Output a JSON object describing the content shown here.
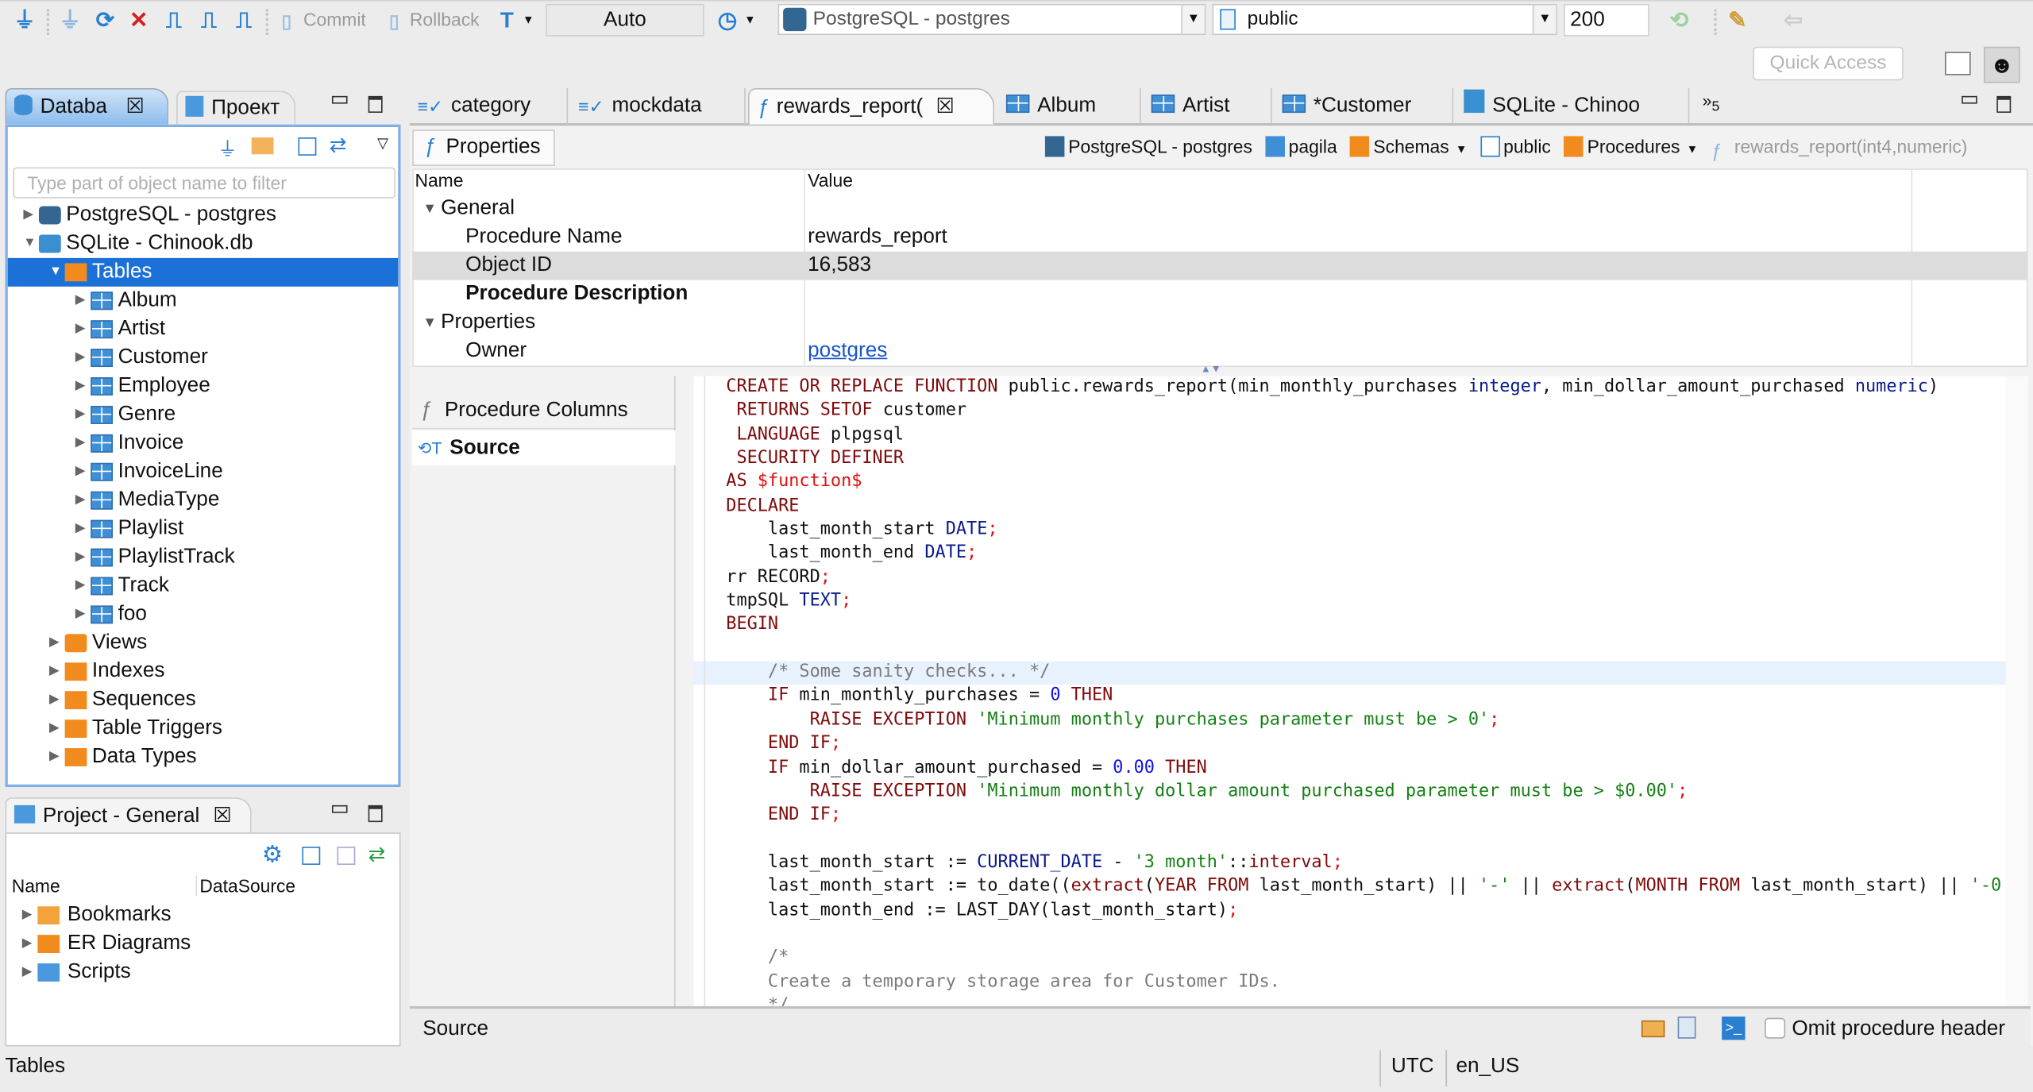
{
  "toolbar": {
    "icons": [
      "new-connection-icon",
      "connect-icon",
      "reconnect-icon",
      "disconnect-icon",
      "transaction-icon",
      "commit-mode-icon",
      "new-transaction-icon"
    ],
    "commit_label": "Commit",
    "rollback_label": "Rollback",
    "transaction_mode": "Auto",
    "connection": "PostgreSQL - postgres",
    "schema": "public",
    "result_limit": "200",
    "quick_access_placeholder": "Quick Access"
  },
  "left_panel": {
    "tabs": [
      {
        "label": "Databa",
        "active": true
      },
      {
        "label": "Проект",
        "active": false
      }
    ],
    "filter_placeholder": "Type part of object name to filter",
    "tree": [
      {
        "label": "PostgreSQL - postgres",
        "level": 0,
        "expanded": false,
        "icon": "postgres-connection"
      },
      {
        "label": "SQLite - Chinook.db",
        "level": 0,
        "expanded": true,
        "icon": "sqlite-connection"
      },
      {
        "label": "Tables",
        "level": 1,
        "expanded": true,
        "icon": "tables-folder",
        "selected": true
      },
      {
        "label": "Album",
        "level": 2,
        "expanded": false,
        "icon": "table"
      },
      {
        "label": "Artist",
        "level": 2,
        "expanded": false,
        "icon": "table"
      },
      {
        "label": "Customer",
        "level": 2,
        "expanded": false,
        "icon": "table"
      },
      {
        "label": "Employee",
        "level": 2,
        "expanded": false,
        "icon": "table"
      },
      {
        "label": "Genre",
        "level": 2,
        "expanded": false,
        "icon": "table"
      },
      {
        "label": "Invoice",
        "level": 2,
        "expanded": false,
        "icon": "table"
      },
      {
        "label": "InvoiceLine",
        "level": 2,
        "expanded": false,
        "icon": "table"
      },
      {
        "label": "MediaType",
        "level": 2,
        "expanded": false,
        "icon": "table"
      },
      {
        "label": "Playlist",
        "level": 2,
        "expanded": false,
        "icon": "table"
      },
      {
        "label": "PlaylistTrack",
        "level": 2,
        "expanded": false,
        "icon": "table"
      },
      {
        "label": "Track",
        "level": 2,
        "expanded": false,
        "icon": "table"
      },
      {
        "label": "foo",
        "level": 2,
        "expanded": false,
        "icon": "table"
      },
      {
        "label": "Views",
        "level": 1,
        "expanded": false,
        "icon": "views"
      },
      {
        "label": "Indexes",
        "level": 1,
        "expanded": false,
        "icon": "folder"
      },
      {
        "label": "Sequences",
        "level": 1,
        "expanded": false,
        "icon": "folder"
      },
      {
        "label": "Table Triggers",
        "level": 1,
        "expanded": false,
        "icon": "folder"
      },
      {
        "label": "Data Types",
        "level": 1,
        "expanded": false,
        "icon": "folder"
      }
    ]
  },
  "project_panel": {
    "tab_label": "Project - General",
    "columns": [
      "Name",
      "DataSource"
    ],
    "items": [
      {
        "label": "Bookmarks",
        "icon": "bookmarks"
      },
      {
        "label": "ER Diagrams",
        "icon": "er-diagrams"
      },
      {
        "label": "Scripts",
        "icon": "scripts"
      }
    ]
  },
  "editor": {
    "tabs": [
      {
        "label": "category",
        "icon": "sql"
      },
      {
        "label": "mockdata",
        "icon": "sql"
      },
      {
        "label": "rewards_report(",
        "icon": "function",
        "active": true
      },
      {
        "label": "Album",
        "icon": "table"
      },
      {
        "label": "Artist",
        "icon": "table"
      },
      {
        "label": "*Customer",
        "icon": "table"
      },
      {
        "label": "SQLite - Chinoo",
        "icon": "sqlite"
      }
    ],
    "overflow_count": "5",
    "subtab": "Properties",
    "breadcrumb": [
      "PostgreSQL - postgres",
      "pagila",
      "Schemas",
      "public",
      "Procedures",
      "rewards_report(int4,numeric)"
    ],
    "properties": {
      "headers": [
        "Name",
        "Value"
      ],
      "rows": [
        {
          "name": "General",
          "value": "",
          "group": true
        },
        {
          "name": "Procedure Name",
          "value": "rewards_report"
        },
        {
          "name": "Object ID",
          "value": "16,583",
          "highlight": true
        },
        {
          "name": "Procedure Description",
          "value": "",
          "bold": true
        },
        {
          "name": "Properties",
          "value": "",
          "group": true
        },
        {
          "name": "Owner",
          "value": "postgres",
          "link": true
        }
      ]
    },
    "side_tabs": [
      {
        "label": "Procedure Columns",
        "active": false
      },
      {
        "label": "Source",
        "active": true
      }
    ],
    "code": [
      [
        [
          "k",
          "CREATE OR REPLACE FUNCTION"
        ],
        [
          "p",
          " public.rewards_report(min_monthly_purchases "
        ],
        [
          "t",
          "integer"
        ],
        [
          "p",
          ", min_dollar_amount_purchased "
        ],
        [
          "t",
          "numeric"
        ],
        [
          "p",
          ")"
        ]
      ],
      [
        [
          "p",
          " "
        ],
        [
          "k",
          "RETURNS SETOF"
        ],
        [
          "p",
          " customer"
        ]
      ],
      [
        [
          "p",
          " "
        ],
        [
          "k",
          "LANGUAGE"
        ],
        [
          "p",
          " plpgsql"
        ]
      ],
      [
        [
          "p",
          " "
        ],
        [
          "k",
          "SECURITY DEFINER"
        ]
      ],
      [
        [
          "k",
          "AS"
        ],
        [
          "p",
          " "
        ],
        [
          "r",
          "$function$"
        ]
      ],
      [
        [
          "k",
          "DECLARE"
        ]
      ],
      [
        [
          "p",
          "    last_month_start "
        ],
        [
          "t",
          "DATE"
        ],
        [
          "r",
          ";"
        ]
      ],
      [
        [
          "p",
          "    last_month_end "
        ],
        [
          "t",
          "DATE"
        ],
        [
          "r",
          ";"
        ]
      ],
      [
        [
          "p",
          "rr RECORD"
        ],
        [
          "r",
          ";"
        ]
      ],
      [
        [
          "p",
          "tmpSQL "
        ],
        [
          "t",
          "TEXT"
        ],
        [
          "r",
          ";"
        ]
      ],
      [
        [
          "k",
          "BEGIN"
        ]
      ],
      [],
      [
        [
          "c",
          "    /* Some sanity checks... */"
        ]
      ],
      [
        [
          "p",
          "    "
        ],
        [
          "k",
          "IF"
        ],
        [
          "p",
          " min_monthly_purchases = "
        ],
        [
          "n",
          "0"
        ],
        [
          "p",
          " "
        ],
        [
          "k",
          "THEN"
        ]
      ],
      [
        [
          "p",
          "        "
        ],
        [
          "k",
          "RAISE EXCEPTION"
        ],
        [
          "p",
          " "
        ],
        [
          "s",
          "'Minimum monthly purchases parameter must be > 0'"
        ],
        [
          "r",
          ";"
        ]
      ],
      [
        [
          "p",
          "    "
        ],
        [
          "k",
          "END IF"
        ],
        [
          "r",
          ";"
        ]
      ],
      [
        [
          "p",
          "    "
        ],
        [
          "k",
          "IF"
        ],
        [
          "p",
          " min_dollar_amount_purchased = "
        ],
        [
          "n",
          "0.00"
        ],
        [
          "p",
          " "
        ],
        [
          "k",
          "THEN"
        ]
      ],
      [
        [
          "p",
          "        "
        ],
        [
          "k",
          "RAISE EXCEPTION"
        ],
        [
          "p",
          " "
        ],
        [
          "s",
          "'Minimum monthly dollar amount purchased parameter must be > $0.00'"
        ],
        [
          "r",
          ";"
        ]
      ],
      [
        [
          "p",
          "    "
        ],
        [
          "k",
          "END IF"
        ],
        [
          "r",
          ";"
        ]
      ],
      [],
      [
        [
          "p",
          "    last_month_start := "
        ],
        [
          "t",
          "CURRENT_DATE"
        ],
        [
          "p",
          " - "
        ],
        [
          "s",
          "'3 month'"
        ],
        [
          "p",
          "::"
        ],
        [
          "k",
          "interval"
        ],
        [
          "r",
          ";"
        ]
      ],
      [
        [
          "p",
          "    last_month_start := to_date(("
        ],
        [
          "k",
          "extract"
        ],
        [
          "p",
          "("
        ],
        [
          "k",
          "YEAR FROM"
        ],
        [
          "p",
          " last_month_start) || "
        ],
        [
          "s",
          "'-'"
        ],
        [
          "p",
          " || "
        ],
        [
          "k",
          "extract"
        ],
        [
          "p",
          "("
        ],
        [
          "k",
          "MONTH FROM"
        ],
        [
          "p",
          " last_month_start) || "
        ],
        [
          "s",
          "'-0"
        ]
      ],
      [
        [
          "p",
          "    last_month_end := LAST_DAY(last_month_start)"
        ],
        [
          "r",
          ";"
        ]
      ],
      [],
      [
        [
          "c",
          "    /*"
        ]
      ],
      [
        [
          "c",
          "    Create a temporary storage area for Customer IDs."
        ]
      ],
      [
        [
          "c",
          "    */"
        ]
      ]
    ],
    "highlighted_line": 13,
    "bottom": {
      "label": "Source",
      "omit_header_label": "Omit procedure header",
      "omit_header_checked": false
    }
  },
  "status_bar": {
    "left": "Tables",
    "timezone": "UTC",
    "locale": "en_US"
  },
  "colors": {
    "selection": "#1c71d8",
    "keyword": "#7f0a0a",
    "type": "#0a1a8a",
    "string": "#158015",
    "comment": "#7a7a7a"
  }
}
